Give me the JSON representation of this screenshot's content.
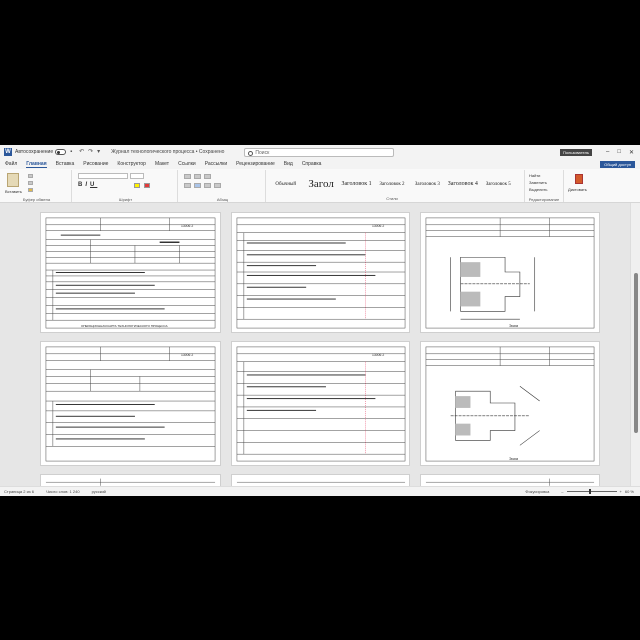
{
  "titlebar": {
    "autosave": "Автосохранение",
    "doc_title": "Журнал технологического процесса • Сохранено",
    "search": "Поиск",
    "user": "Пользователь"
  },
  "tabs": [
    "Файл",
    "Главная",
    "Вставка",
    "Рисование",
    "Конструктор",
    "Макет",
    "Ссылки",
    "Рассылки",
    "Рецензирование",
    "Вид",
    "Справка"
  ],
  "share_label": "Общий доступ",
  "ribbon": {
    "paste": "Вставить",
    "clipboard": "Буфер обмена",
    "font": "Шрифт",
    "paragraph": "Абзац",
    "styles_group": "Стили",
    "editing": "Редактирование",
    "find": "Найти",
    "replace": "Заменить",
    "select": "Выделить",
    "dictate": "Диктовать",
    "styles": [
      "Обычный",
      "Загол",
      "Заголовок 1",
      "Заголовок 2",
      "Заголовок 3",
      "Заголовок 4",
      "Заголовок 5"
    ]
  },
  "pages": {
    "code1": "13006 2",
    "code2": "13006 2",
    "sketch": "Эскиз",
    "footer1": "ОПЕРАЦИОННАЯ КАРТА ТЕХНОЛОГИЧЕСКОГО ПРОЦЕССА",
    "footer2": "КАРТА ЭСКИЗОВ"
  },
  "status": {
    "page": "Страница 2 из 6",
    "words": "Число слов: 1 240",
    "lang": "русский",
    "focus": "Фокусировка",
    "zoom": "60 %"
  }
}
